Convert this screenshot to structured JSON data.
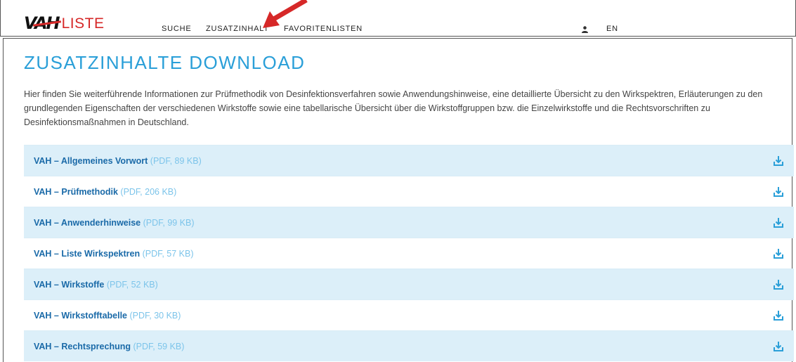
{
  "header": {
    "logo_vah": "VAH",
    "logo_liste": "LISTE",
    "nav": [
      "SUCHE",
      "ZUSATZINHALT",
      "FAVORITENLISTEN"
    ],
    "lang": "EN",
    "user_icon": "user-icon",
    "annotation": "red-arrow-pointing-to-zusatzinhalt"
  },
  "main": {
    "title": "ZUSATZINHALTE DOWNLOAD",
    "intro": "Hier finden Sie weiterführende Informationen zur Prüfmethodik von Desinfektionsverfahren sowie Anwendungshinweise, eine detaillierte Übersicht zu den Wirkspektren, Erläuterungen zu den grundlegenden Eigenschaften der verschiedenen Wirkstoffe sowie eine tabellarische Übersicht über die Wirkstoffgruppen bzw. die Einzelwirkstoffe und die Rechtsvorschriften zu Desinfektionsmaßnahmen in Deutschland.",
    "downloads": [
      {
        "name": "VAH – Allgemeines Vorwort",
        "meta": "(PDF, 89 KB)"
      },
      {
        "name": "VAH – Prüfmethodik",
        "meta": "(PDF, 206 KB)"
      },
      {
        "name": "VAH – Anwenderhinweise",
        "meta": "(PDF, 99 KB)"
      },
      {
        "name": "VAH – Liste Wirkspektren",
        "meta": "(PDF, 57 KB)"
      },
      {
        "name": "VAH – Wirkstoffe",
        "meta": "(PDF, 52 KB)"
      },
      {
        "name": "VAH – Wirkstofftabelle",
        "meta": "(PDF, 30 KB)"
      },
      {
        "name": "VAH – Rechtsprechung",
        "meta": "(PDF, 59 KB)"
      }
    ],
    "download_icon": "download-icon"
  },
  "colors": {
    "accent": "#2a9fd8",
    "link": "#1a6aa8",
    "meta": "#7cc4ea",
    "row_alt": "#dcefF9",
    "brand_red": "#d62828"
  }
}
